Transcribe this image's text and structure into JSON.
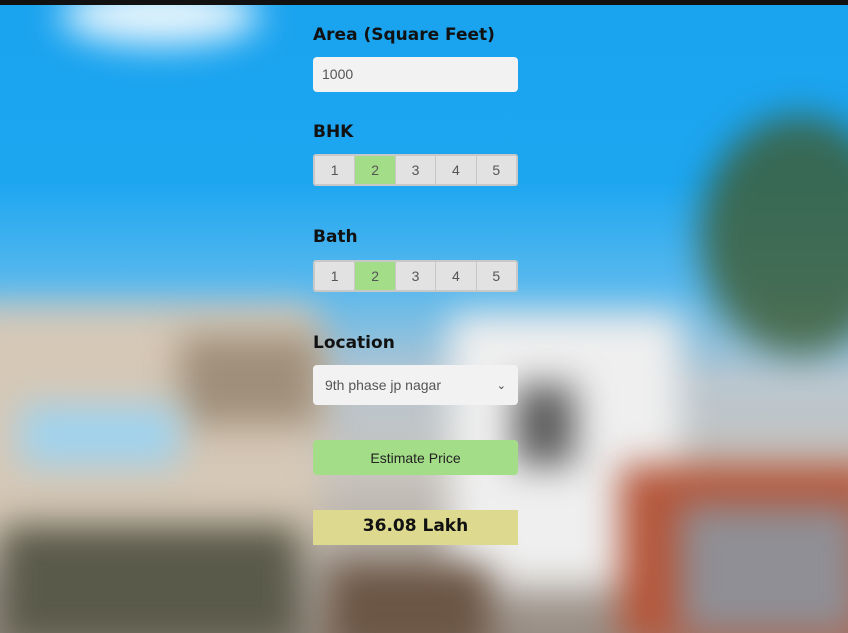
{
  "form": {
    "area": {
      "label": "Area (Square Feet)",
      "value": "1000"
    },
    "bhk": {
      "label": "BHK",
      "options": [
        "1",
        "2",
        "3",
        "4",
        "5"
      ],
      "selected": "2"
    },
    "bath": {
      "label": "Bath",
      "options": [
        "1",
        "2",
        "3",
        "4",
        "5"
      ],
      "selected": "2"
    },
    "location": {
      "label": "Location",
      "value": "9th phase jp nagar"
    },
    "submit_label": "Estimate Price",
    "result": "36.08 Lakh"
  },
  "colors": {
    "accent_green": "#a4dd88",
    "result_yellow": "#ddd98f",
    "sky_blue": "#1aa3ef"
  }
}
